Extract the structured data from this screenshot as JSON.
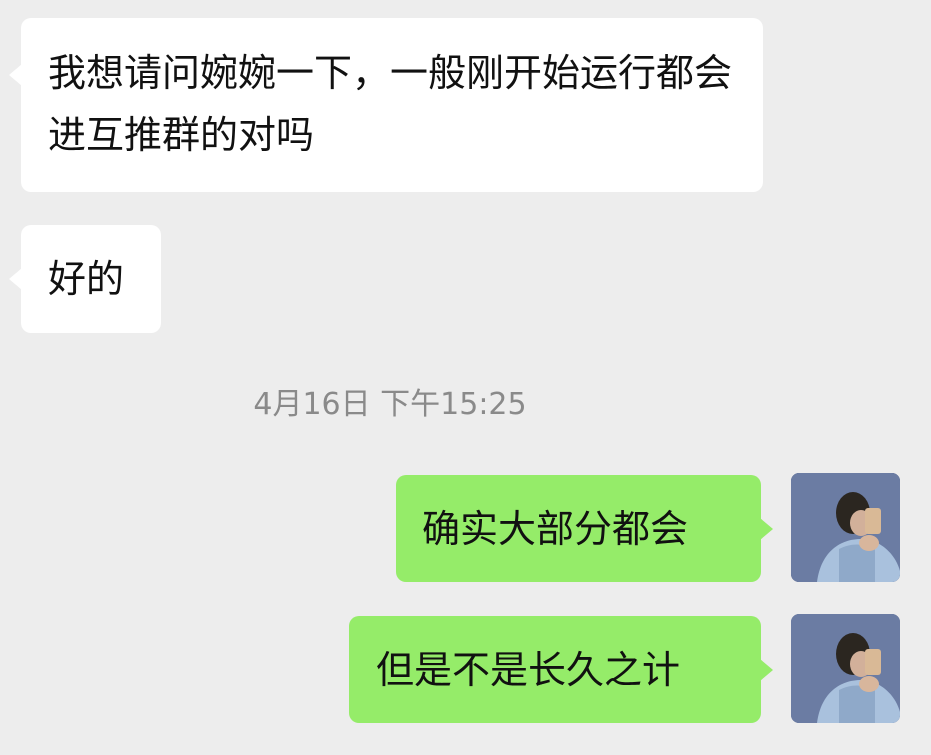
{
  "chat": {
    "messages": [
      {
        "direction": "incoming",
        "text": "我想请问婉婉一下，一般刚开始运行都会进互推群的对吗"
      },
      {
        "direction": "incoming",
        "text": "好的"
      },
      {
        "direction": "outgoing",
        "text": "确实大部分都会"
      },
      {
        "direction": "outgoing",
        "text": "但是不是长久之计"
      }
    ],
    "timestamp": "4月16日 下午15:25"
  },
  "colors": {
    "background": "#ededed",
    "incoming_bubble": "#ffffff",
    "outgoing_bubble": "#95ec69",
    "timestamp_text": "#8a8a8a"
  },
  "icons": {
    "avatar": "user-avatar-photo"
  }
}
